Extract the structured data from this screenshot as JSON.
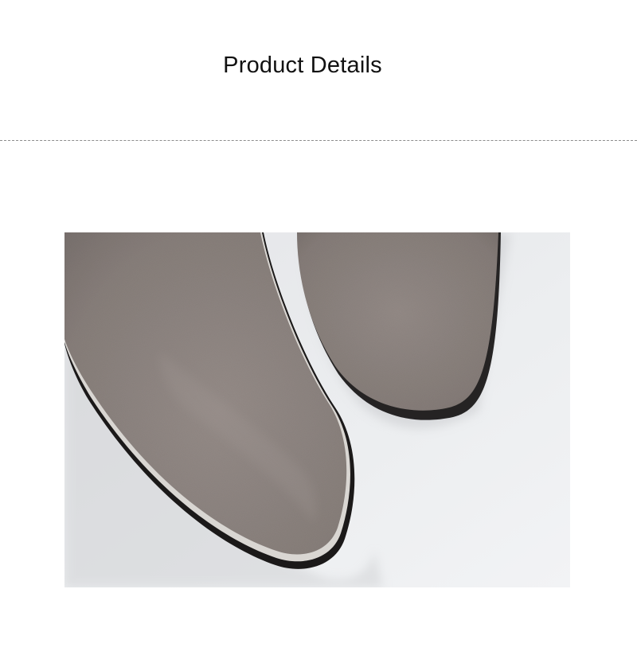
{
  "section": {
    "title": "Product Details"
  },
  "photo": {
    "subject": "suede-pointed-toe-boots",
    "colors": {
      "background": "#e9eaec",
      "suede": "#8c8380",
      "sole": "#1b1919",
      "welt": "#d9d6d2"
    }
  }
}
